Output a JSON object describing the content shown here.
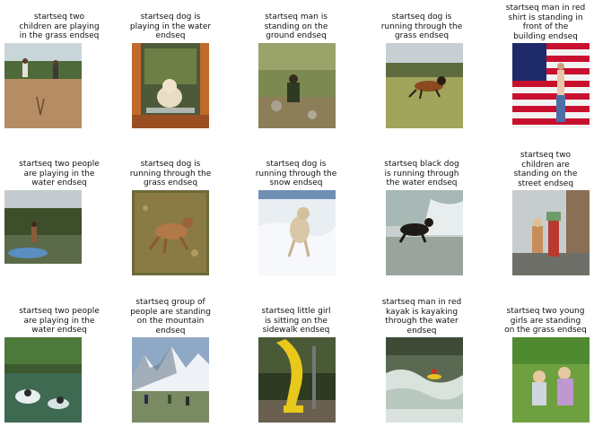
{
  "captions": [
    "startseq two\nchildren are playing\nin the grass endseq",
    "startseq dog is\nplaying in the water\nendseq",
    "startseq man is\nstanding on the\nground endseq",
    "startseq dog is\nrunning through the\ngrass endseq",
    "startseq man in red\nshirt is standing in\nfront of the\nbuilding endseq",
    "startseq two people\nare playing in the\nwater endseq",
    "startseq dog is\nrunning through the\ngrass endseq",
    "startseq dog is\nrunning through the\nsnow endseq",
    "startseq black dog\nis running through\nthe water endseq",
    "startseq two\nchildren are\nstanding on the\nstreet endseq",
    "startseq two people\nare playing in the\nwater endseq",
    "startseq group of\npeople are standing\non the mountain\nendseq",
    "startseq little girl\nis sitting on the\nsidewalk endseq",
    "startseq man in red\nkayak is kayaking\nthrough the water\nendseq",
    "startseq two young\ngirls are standing\non the grass endseq"
  ]
}
